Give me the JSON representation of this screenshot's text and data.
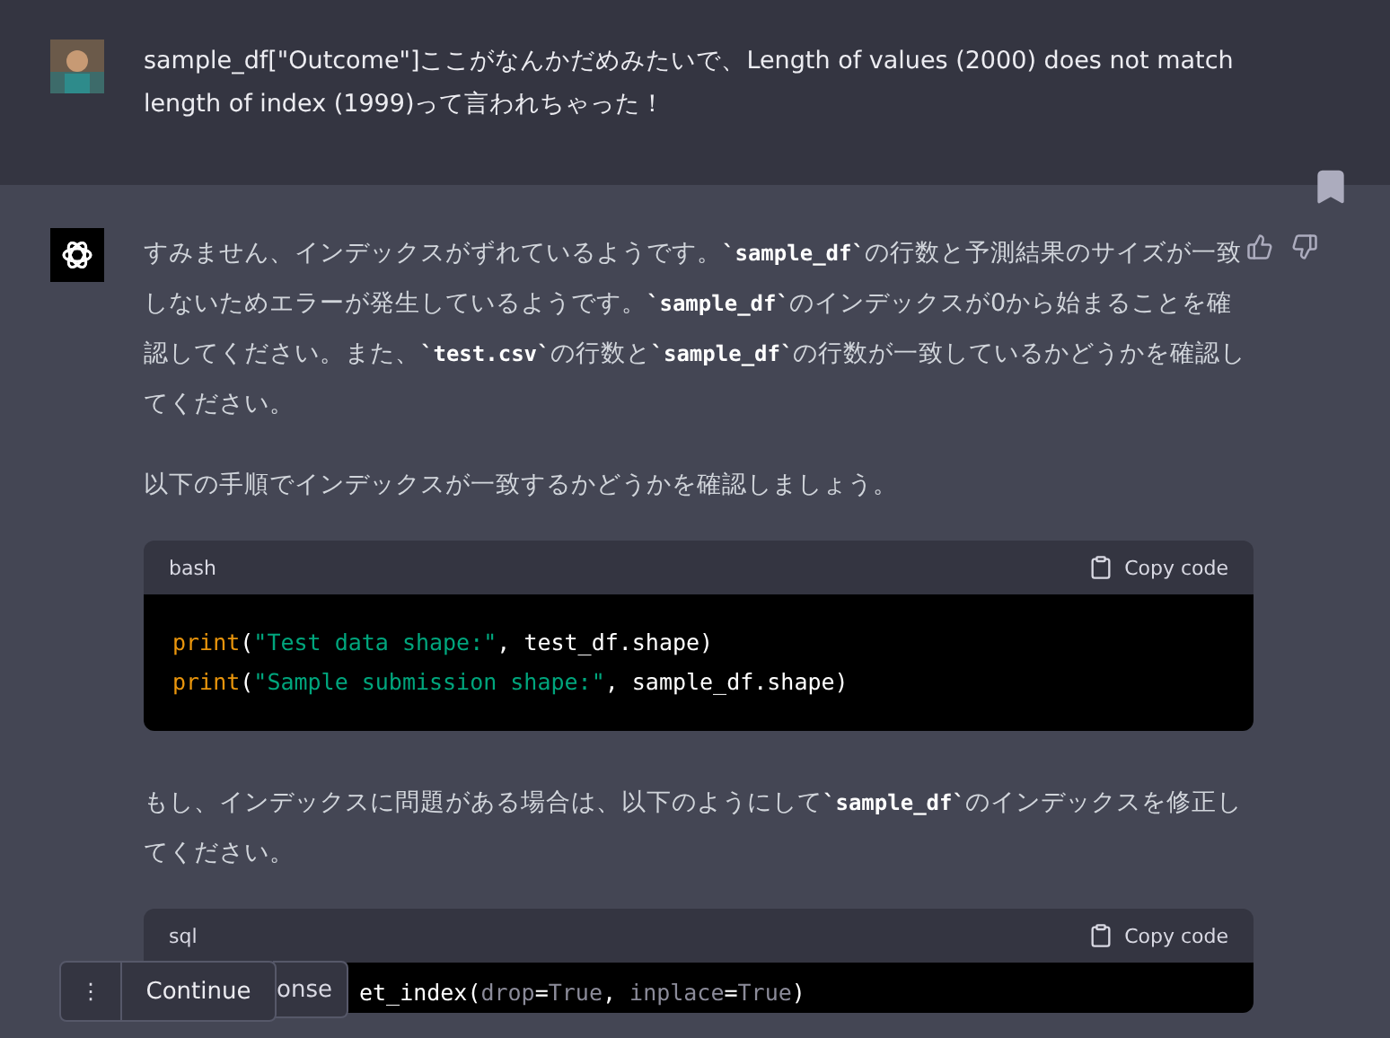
{
  "user_message": {
    "text": "sample_df[\"Outcome\"]ここがなんかだめみたいで、Length of values (2000) does not match length of index (1999)って言われちゃった！"
  },
  "assistant_message": {
    "blocks": [
      {
        "kind": "paragraph",
        "segments": [
          {
            "kind": "text",
            "text": "すみません、インデックスがずれているようです。"
          },
          {
            "kind": "code",
            "text": "`sample_df`"
          },
          {
            "kind": "text",
            "text": "の行数と予測結果のサイズが一致しないためエラーが発生しているようです。"
          },
          {
            "kind": "code",
            "text": "`sample_df`"
          },
          {
            "kind": "text",
            "text": "のインデックスが0から始まることを確認してください。また、"
          },
          {
            "kind": "code",
            "text": "`test.csv`"
          },
          {
            "kind": "text",
            "text": "の行数と"
          },
          {
            "kind": "code",
            "text": "`sample_df`"
          },
          {
            "kind": "text",
            "text": "の行数が一致しているかどうかを確認してください。"
          }
        ]
      },
      {
        "kind": "paragraph",
        "segments": [
          {
            "kind": "text",
            "text": "以下の手順でインデックスが一致するかどうかを確認しましょう。"
          }
        ]
      },
      {
        "kind": "code_block",
        "language": "bash",
        "copy_label": "Copy code",
        "lines": [
          [
            {
              "kind": "func",
              "text": "print"
            },
            {
              "kind": "plain",
              "text": "("
            },
            {
              "kind": "string",
              "text": "\"Test data shape:\""
            },
            {
              "kind": "plain",
              "text": ", test_df.shape)"
            }
          ],
          [
            {
              "kind": "func",
              "text": "print"
            },
            {
              "kind": "plain",
              "text": "("
            },
            {
              "kind": "string",
              "text": "\"Sample submission shape:\""
            },
            {
              "kind": "plain",
              "text": ", sample_df.shape)"
            }
          ]
        ]
      },
      {
        "kind": "paragraph",
        "segments": [
          {
            "kind": "text",
            "text": "もし、インデックスに問題がある場合は、以下のようにして"
          },
          {
            "kind": "code",
            "text": "`sample_df`"
          },
          {
            "kind": "text",
            "text": "のインデックスを修正してください。"
          }
        ]
      },
      {
        "kind": "code_block",
        "language": "sql",
        "copy_label": "Copy code",
        "lines": [
          [
            {
              "kind": "plain",
              "text": "et_index("
            },
            {
              "kind": "muted",
              "text": "drop"
            },
            {
              "kind": "plain",
              "text": "="
            },
            {
              "kind": "muted",
              "text": "True"
            },
            {
              "kind": "plain",
              "text": ", "
            },
            {
              "kind": "muted",
              "text": "inplace"
            },
            {
              "kind": "plain",
              "text": "="
            },
            {
              "kind": "muted",
              "text": "True"
            },
            {
              "kind": "plain",
              "text": ")"
            }
          ]
        ]
      }
    ]
  },
  "regenerate_button": {
    "label": "onse"
  },
  "continue_bar": {
    "menu": "⋮",
    "label": "Continue"
  }
}
